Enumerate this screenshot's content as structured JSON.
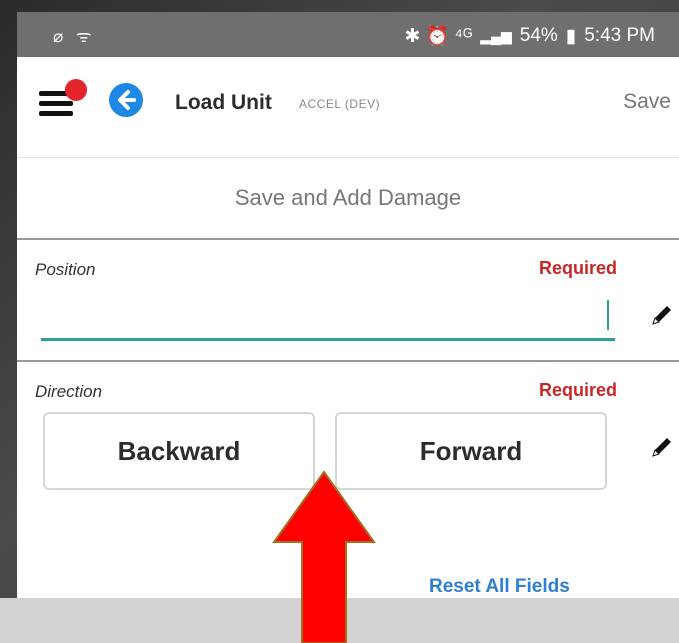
{
  "status_bar": {
    "left_icons": "⌀ ᯤ",
    "right_icons": "✱ ⏰ ⁴ᴳ",
    "battery": "54%",
    "time": "5:43 PM"
  },
  "app_bar": {
    "title": "Load Unit",
    "environment": "ACCEL (DEV)",
    "save_label": "Save"
  },
  "actions": {
    "save_and_add_damage": "Save and Add Damage",
    "reset_all_fields": "Reset All Fields"
  },
  "position_field": {
    "label": "Position",
    "required": "Required",
    "value": "",
    "placeholder": ""
  },
  "direction_field": {
    "label": "Direction",
    "required": "Required",
    "options": [
      "Backward",
      "Forward"
    ]
  },
  "colors": {
    "accent_teal": "#2f9e8f",
    "required_red": "#c62828",
    "link_blue": "#2f7fd1",
    "notification_red": "#e3242b",
    "back_blue": "#1e88e5",
    "arrow_red": "#ff0000"
  },
  "icons": {
    "menu": "hamburger-menu-icon",
    "back": "back-arrow-icon",
    "edit": "pencil-icon",
    "annotation": "up-arrow-icon"
  }
}
